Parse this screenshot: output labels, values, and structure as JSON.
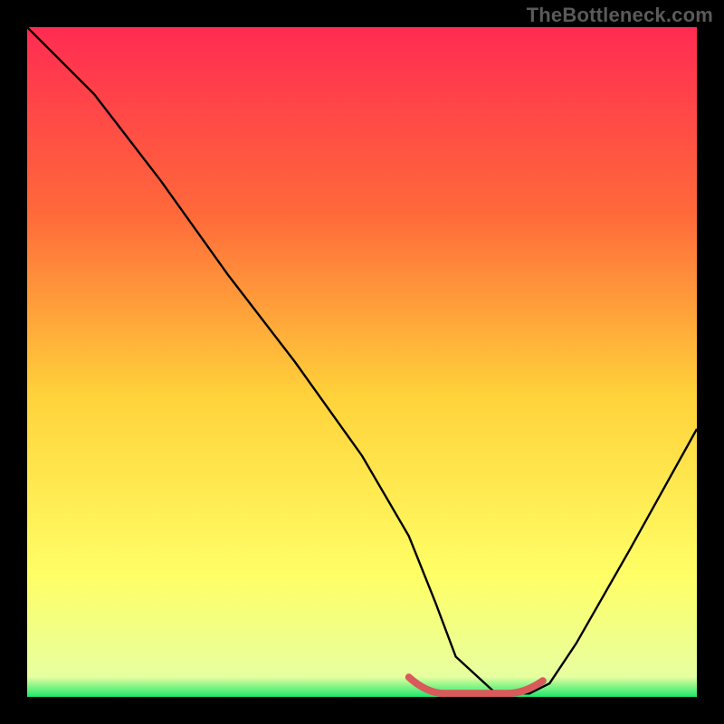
{
  "watermark": "TheBottleneck.com",
  "colors": {
    "background": "#000000",
    "gradient_top": "#ff2b52",
    "gradient_mid1": "#ff6a3a",
    "gradient_mid2": "#ffd23a",
    "gradient_mid3": "#ffff66",
    "gradient_bottom": "#1ee86b",
    "curve": "#000000",
    "accent": "#d85a5a"
  },
  "chart_data": {
    "type": "line",
    "title": "",
    "xlabel": "",
    "ylabel": "",
    "xlim": [
      0,
      100
    ],
    "ylim": [
      0,
      100
    ],
    "series": [
      {
        "name": "bottleneck-curve",
        "x": [
          0,
          4,
          10,
          20,
          30,
          40,
          50,
          57,
          61,
          64,
          70,
          75,
          78,
          82,
          90,
          100
        ],
        "values": [
          100,
          96,
          90,
          77,
          63,
          50,
          36,
          24,
          14,
          6,
          0.5,
          0.5,
          2,
          8,
          22,
          40
        ]
      }
    ],
    "accent_region": {
      "x_start": 57,
      "x_end": 77,
      "y": 0.5
    }
  }
}
